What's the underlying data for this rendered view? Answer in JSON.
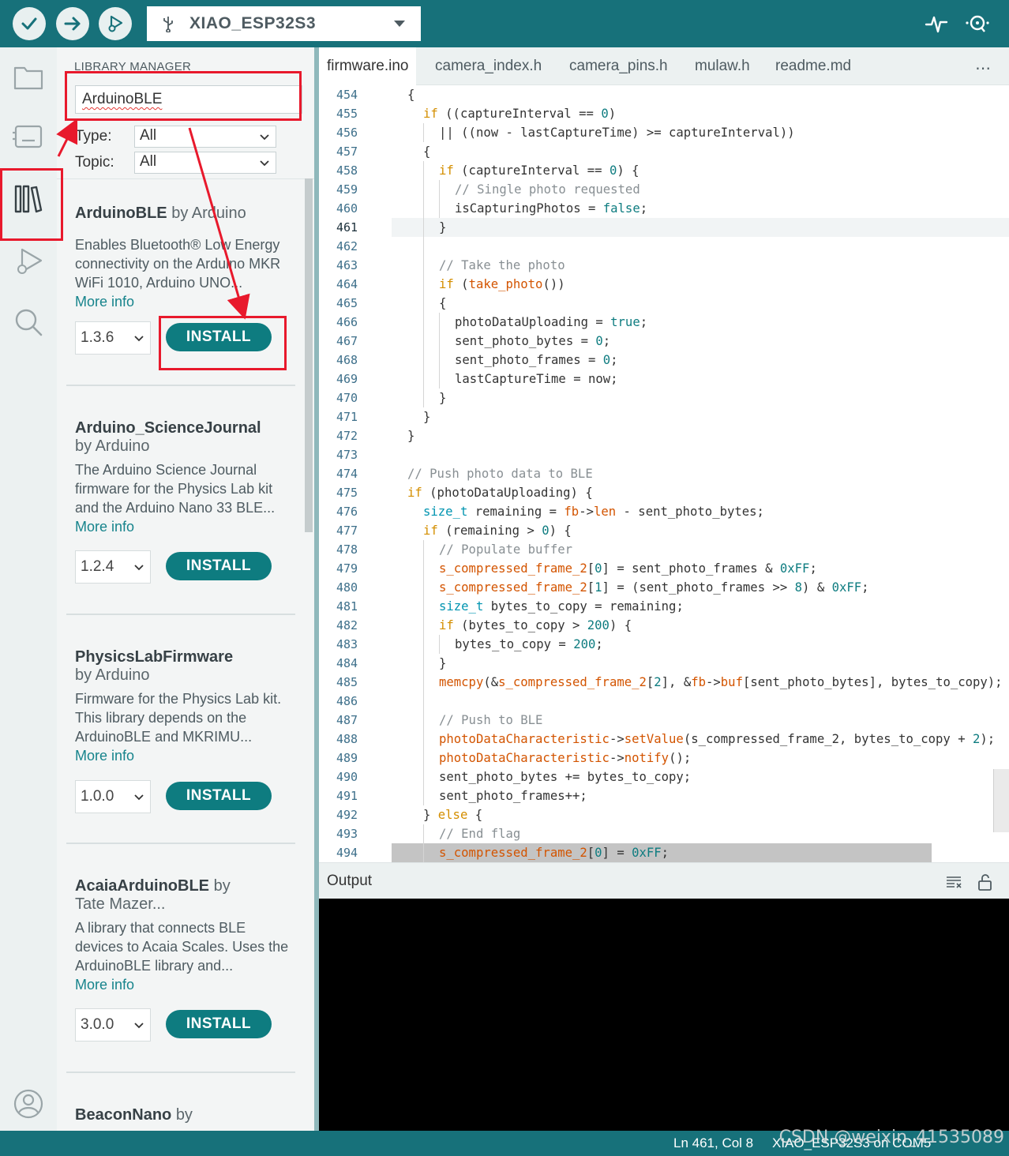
{
  "toolbar": {
    "verify_icon": "check-icon",
    "upload_icon": "arrow-right-icon",
    "debug_icon": "debug-icon",
    "board_name": "XIAO_ESP32S3",
    "serial_plotter_icon": "pulse-icon",
    "serial_monitor_icon": "magnifier-dots-icon"
  },
  "library_panel": {
    "header": "LIBRARY MANAGER",
    "search_value": "ArduinoBLE",
    "type_label": "Type:",
    "type_value": "All",
    "topic_label": "Topic:",
    "topic_value": "All",
    "libraries": [
      {
        "name": "ArduinoBLE",
        "by": "by Arduino",
        "description": "Enables Bluetooth® Low Energy connectivity on the Arduino MKR WiFi 1010, Arduino UNO...",
        "more_info": "More info",
        "version": "1.3.6",
        "install_label": "INSTALL"
      },
      {
        "name": "Arduino_ScienceJournal",
        "by": "by Arduino",
        "description": "The Arduino Science Journal firmware for the Physics Lab kit and the Arduino Nano 33 BLE...",
        "more_info": "More info",
        "version": "1.2.4",
        "install_label": "INSTALL"
      },
      {
        "name": "PhysicsLabFirmware",
        "by": "by Arduino",
        "description": "Firmware for the Physics Lab kit. This library depends on the ArduinoBLE and MKRIMU...",
        "more_info": "More info",
        "version": "1.0.0",
        "install_label": "INSTALL"
      },
      {
        "name": "AcaiaArduinoBLE",
        "by": "by",
        "by2": "Tate Mazer...",
        "description": "A library that connects BLE devices to Acaia Scales. Uses the ArduinoBLE library and...",
        "more_info": "More info",
        "version": "3.0.0",
        "install_label": "INSTALL"
      },
      {
        "name": "BeaconNano",
        "by": "by"
      }
    ]
  },
  "tabs": [
    "firmware.ino",
    "camera_index.h",
    "camera_pins.h",
    "mulaw.h",
    "readme.md"
  ],
  "tabs_more": "⋯",
  "editor": {
    "current_line": 461,
    "lines": [
      {
        "n": 454,
        "ind": 0,
        "tokens": [
          [
            "",
            "{"
          ]
        ]
      },
      {
        "n": 455,
        "ind": 1,
        "tokens": [
          [
            "kw",
            "if"
          ],
          [
            "",
            " ((captureInterval == "
          ],
          [
            "nm",
            "0"
          ],
          [
            "",
            ")"
          ]
        ]
      },
      {
        "n": 456,
        "ind": 2,
        "tokens": [
          [
            "",
            "|| ((now - lastCaptureTime) >= captureInterval))"
          ]
        ]
      },
      {
        "n": 457,
        "ind": 1,
        "tokens": [
          [
            "",
            "{"
          ]
        ]
      },
      {
        "n": 458,
        "ind": 2,
        "tokens": [
          [
            "kw",
            "if"
          ],
          [
            "",
            " (captureInterval == "
          ],
          [
            "nm",
            "0"
          ],
          [
            "",
            ") {"
          ]
        ]
      },
      {
        "n": 459,
        "ind": 3,
        "tokens": [
          [
            "cm",
            "// Single photo requested"
          ]
        ]
      },
      {
        "n": 460,
        "ind": 3,
        "tokens": [
          [
            "",
            "isCapturingPhotos = "
          ],
          [
            "nm",
            "false"
          ],
          [
            "",
            ";"
          ]
        ]
      },
      {
        "n": 461,
        "ind": 2,
        "tokens": [
          [
            "",
            "}"
          ]
        ]
      },
      {
        "n": 462,
        "ind": 0,
        "tokens": []
      },
      {
        "n": 463,
        "ind": 2,
        "tokens": [
          [
            "cm",
            "// Take the photo"
          ]
        ]
      },
      {
        "n": 464,
        "ind": 2,
        "tokens": [
          [
            "kw",
            "if"
          ],
          [
            "",
            " ("
          ],
          [
            "fn",
            "take_photo"
          ],
          [
            "",
            "())"
          ]
        ]
      },
      {
        "n": 465,
        "ind": 2,
        "tokens": [
          [
            "",
            "{"
          ]
        ]
      },
      {
        "n": 466,
        "ind": 3,
        "tokens": [
          [
            "",
            "photoDataUploading = "
          ],
          [
            "nm",
            "true"
          ],
          [
            "",
            ";"
          ]
        ]
      },
      {
        "n": 467,
        "ind": 3,
        "tokens": [
          [
            "",
            "sent_photo_bytes = "
          ],
          [
            "nm",
            "0"
          ],
          [
            "",
            ";"
          ]
        ]
      },
      {
        "n": 468,
        "ind": 3,
        "tokens": [
          [
            "",
            "sent_photo_frames = "
          ],
          [
            "nm",
            "0"
          ],
          [
            "",
            ";"
          ]
        ]
      },
      {
        "n": 469,
        "ind": 3,
        "tokens": [
          [
            "",
            "lastCaptureTime = now;"
          ]
        ]
      },
      {
        "n": 470,
        "ind": 2,
        "tokens": [
          [
            "",
            "}"
          ]
        ]
      },
      {
        "n": 471,
        "ind": 1,
        "tokens": [
          [
            "",
            "}"
          ]
        ]
      },
      {
        "n": 472,
        "ind": 0,
        "tokens": [
          [
            "",
            "}"
          ]
        ]
      },
      {
        "n": 473,
        "ind": 0,
        "tokens": []
      },
      {
        "n": 474,
        "ind": 0,
        "tokens": [
          [
            "cm",
            "// Push photo data to BLE"
          ]
        ]
      },
      {
        "n": 475,
        "ind": 0,
        "tokens": [
          [
            "kw",
            "if"
          ],
          [
            "",
            " (photoDataUploading) {"
          ]
        ]
      },
      {
        "n": 476,
        "ind": 1,
        "tokens": [
          [
            "ty",
            "size_t"
          ],
          [
            "",
            " remaining = "
          ],
          [
            "fn",
            "fb"
          ],
          [
            "",
            "->"
          ],
          [
            "fn",
            "len"
          ],
          [
            "",
            " - sent_photo_bytes;"
          ]
        ]
      },
      {
        "n": 477,
        "ind": 1,
        "tokens": [
          [
            "kw",
            "if"
          ],
          [
            "",
            " (remaining > "
          ],
          [
            "nm",
            "0"
          ],
          [
            "",
            ") {"
          ]
        ]
      },
      {
        "n": 478,
        "ind": 2,
        "tokens": [
          [
            "cm",
            "// Populate buffer"
          ]
        ]
      },
      {
        "n": 479,
        "ind": 2,
        "tokens": [
          [
            "fn",
            "s_compressed_frame_2"
          ],
          [
            "",
            "["
          ],
          [
            "nm",
            "0"
          ],
          [
            "",
            "] = sent_photo_frames & "
          ],
          [
            "nm",
            "0xFF"
          ],
          [
            "",
            ";"
          ]
        ]
      },
      {
        "n": 480,
        "ind": 2,
        "tokens": [
          [
            "fn",
            "s_compressed_frame_2"
          ],
          [
            "",
            "["
          ],
          [
            "nm",
            "1"
          ],
          [
            "",
            "] = (sent_photo_frames >> "
          ],
          [
            "nm",
            "8"
          ],
          [
            "",
            ") & "
          ],
          [
            "nm",
            "0xFF"
          ],
          [
            "",
            ";"
          ]
        ]
      },
      {
        "n": 481,
        "ind": 2,
        "tokens": [
          [
            "ty",
            "size_t"
          ],
          [
            "",
            " bytes_to_copy = remaining;"
          ]
        ]
      },
      {
        "n": 482,
        "ind": 2,
        "tokens": [
          [
            "kw",
            "if"
          ],
          [
            "",
            " (bytes_to_copy > "
          ],
          [
            "nm",
            "200"
          ],
          [
            "",
            ") {"
          ]
        ]
      },
      {
        "n": 483,
        "ind": 3,
        "tokens": [
          [
            "",
            "bytes_to_copy = "
          ],
          [
            "nm",
            "200"
          ],
          [
            "",
            ";"
          ]
        ]
      },
      {
        "n": 484,
        "ind": 2,
        "tokens": [
          [
            "",
            "}"
          ]
        ]
      },
      {
        "n": 485,
        "ind": 2,
        "tokens": [
          [
            "fn",
            "memcpy"
          ],
          [
            "",
            "(&"
          ],
          [
            "fn",
            "s_compressed_frame_2"
          ],
          [
            "",
            "["
          ],
          [
            "nm",
            "2"
          ],
          [
            "",
            "], &"
          ],
          [
            "fn",
            "fb"
          ],
          [
            "",
            "->"
          ],
          [
            "fn",
            "buf"
          ],
          [
            "",
            "[sent_photo_bytes], bytes_to_copy);"
          ]
        ]
      },
      {
        "n": 486,
        "ind": 0,
        "tokens": []
      },
      {
        "n": 487,
        "ind": 2,
        "tokens": [
          [
            "cm",
            "// Push to BLE"
          ]
        ]
      },
      {
        "n": 488,
        "ind": 2,
        "tokens": [
          [
            "fn",
            "photoDataCharacteristic"
          ],
          [
            "",
            "->"
          ],
          [
            "fn",
            "setValue"
          ],
          [
            "",
            "(s_compressed_frame_2, bytes_to_copy + "
          ],
          [
            "nm",
            "2"
          ],
          [
            "",
            ");"
          ]
        ]
      },
      {
        "n": 489,
        "ind": 2,
        "tokens": [
          [
            "fn",
            "photoDataCharacteristic"
          ],
          [
            "",
            "->"
          ],
          [
            "fn",
            "notify"
          ],
          [
            "",
            "();"
          ]
        ]
      },
      {
        "n": 490,
        "ind": 2,
        "tokens": [
          [
            "",
            "sent_photo_bytes += bytes_to_copy;"
          ]
        ]
      },
      {
        "n": 491,
        "ind": 2,
        "tokens": [
          [
            "",
            "sent_photo_frames++;"
          ]
        ]
      },
      {
        "n": 492,
        "ind": 1,
        "tokens": [
          [
            "",
            "} "
          ],
          [
            "kw",
            "else"
          ],
          [
            "",
            " {"
          ]
        ]
      },
      {
        "n": 493,
        "ind": 2,
        "tokens": [
          [
            "cm",
            "// End flag"
          ]
        ]
      },
      {
        "n": 494,
        "ind": 2,
        "tokens": [
          [
            "fn",
            "s_compressed_frame_2"
          ],
          [
            "",
            "["
          ],
          [
            "nm",
            "0"
          ],
          [
            "",
            "] = "
          ],
          [
            "nm",
            "0xFF"
          ],
          [
            "",
            ";"
          ]
        ]
      }
    ]
  },
  "output": {
    "title": "Output",
    "clear_icon": "clear-lines-icon",
    "lock_icon": "unlock-icon"
  },
  "status": {
    "position": "Ln 461, Col 8",
    "board_port": "XIAO_ESP32S3 on COM5"
  },
  "watermark": "CSDN @weixin_41535089",
  "colors": {
    "brand": "#17717a",
    "install_button": "#0e7c80",
    "annotation": "#e8192c"
  }
}
